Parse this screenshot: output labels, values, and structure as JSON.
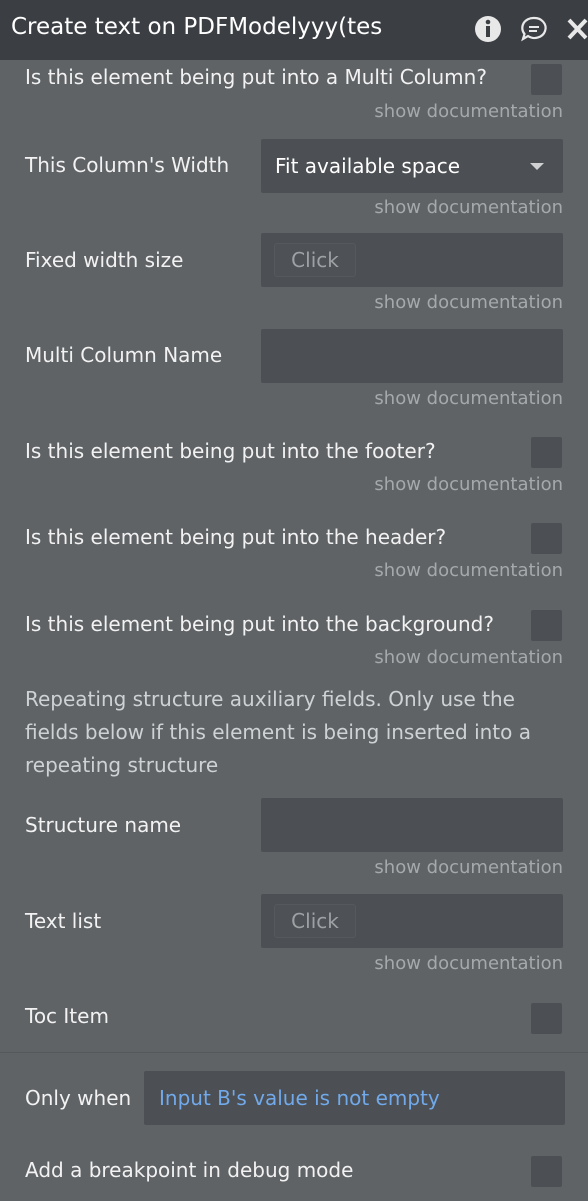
{
  "window": {
    "title": "Create text on PDFModelyyy(tes",
    "icons": [
      "info-icon",
      "comment-icon",
      "close-icon"
    ]
  },
  "fields": {
    "multi_column": {
      "label": "Is this element being put into a Multi Column?",
      "doc": "show documentation"
    },
    "column_width": {
      "label": "This Column's Width",
      "value": "Fit available space",
      "doc": "show documentation"
    },
    "fixed_width": {
      "label": "Fixed width size",
      "button": "Click",
      "doc": "show documentation"
    },
    "multi_column_name": {
      "label": "Multi Column Name",
      "doc": "show documentation"
    },
    "footer": {
      "label": "Is this element being put into the footer?",
      "doc": "show documentation"
    },
    "header": {
      "label": "Is this element being put into the header?",
      "doc": "show documentation"
    },
    "background": {
      "label": "Is this element being put into the background?",
      "doc": "show documentation"
    },
    "repeating_note": "Repeating structure auxiliary fields. Only use the fields below if this element is being inserted into a repeating structure",
    "structure_name": {
      "label": "Structure name",
      "doc": "show documentation"
    },
    "text_list": {
      "label": "Text list",
      "button": "Click",
      "doc": "show documentation"
    },
    "toc_item": {
      "label": "Toc Item"
    }
  },
  "conditions": {
    "only_when_label": "Only when",
    "only_when_value": "Input B's value is not empty",
    "breakpoint_label": "Add a breakpoint in debug mode"
  },
  "colors": {
    "panel_bg": "#5f6366",
    "titlebar_bg": "#3b3f44",
    "input_bg": "#4c5054",
    "link_blue": "#71a9ea",
    "doc_text": "#a6a9ab"
  }
}
